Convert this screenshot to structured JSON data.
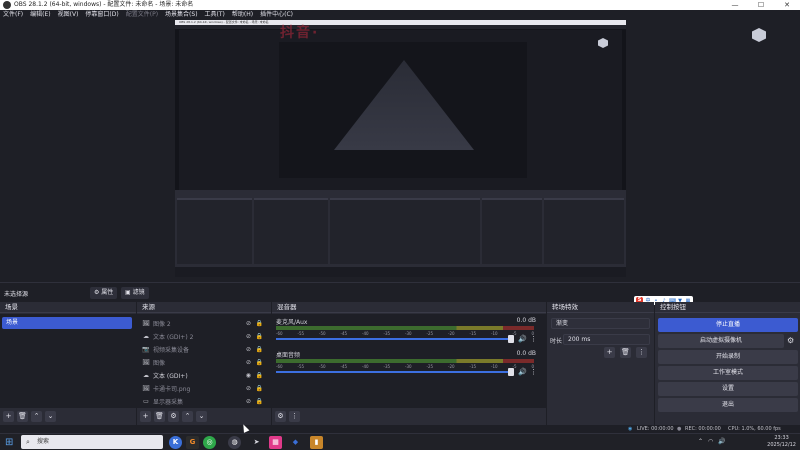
{
  "window": {
    "title": "OBS 28.1.2 (64-bit, windows) - 配置文件: 未命名 - 场景: 未命名",
    "minimize": "—",
    "maximize": "☐",
    "close": "✕"
  },
  "menu": [
    "文件(F)",
    "编辑(E)",
    "视图(V)",
    "停靠窗口(D)",
    "配置文件(P)",
    "场景集合(S)",
    "工具(T)",
    "帮助(H)",
    "插件中心(C)"
  ],
  "preview": {
    "nested_title": "OBS 28.1.2 (64-bit, windows) - 配置文件: 未命名 - 场景: 未命名"
  },
  "scene_bar": {
    "selected": "未选择源",
    "properties": "属性",
    "filters": "滤镜"
  },
  "ime": {
    "label": "中"
  },
  "scenes": {
    "title": "场景",
    "items": [
      "场景"
    ]
  },
  "sources": {
    "title": "来源",
    "items": [
      {
        "icon": "🖼",
        "label": "图像 2",
        "visible": false
      },
      {
        "icon": "☁",
        "label": "文本 (GDI+) 2",
        "visible": false
      },
      {
        "icon": "📷",
        "label": "视频采集设备",
        "visible": false
      },
      {
        "icon": "🖼",
        "label": "图像",
        "visible": false
      },
      {
        "icon": "☁",
        "label": "文本 (GDI+)",
        "visible": true
      },
      {
        "icon": "🖼",
        "label": "卡通卡司.png",
        "visible": false
      },
      {
        "icon": "▭",
        "label": "显示器采集",
        "visible": false
      }
    ]
  },
  "mixer": {
    "title": "混音器",
    "channels": [
      {
        "name": "麦克风/Aux",
        "db": "0.0 dB"
      },
      {
        "name": "桌面音频",
        "db": "0.0 dB"
      }
    ],
    "ticks": [
      "-60",
      "-55",
      "-50",
      "-45",
      "-40",
      "-35",
      "-30",
      "-25",
      "-20",
      "-15",
      "-10",
      "-5",
      "0"
    ]
  },
  "transitions": {
    "title": "转场特效",
    "type": "渐变",
    "duration_label": "时长",
    "duration": "200 ms"
  },
  "controls": {
    "title": "控制按钮",
    "buttons": [
      "停止直播",
      "启动虚拟摄像机",
      "开始录制",
      "工作室模式",
      "设置",
      "退出"
    ]
  },
  "status": {
    "live": "LIVE: 00:00:00",
    "rec": "REC: 00:00:00",
    "cpu": "CPU: 1.0%, 60.00 fps"
  },
  "taskbar": {
    "search": "搜索",
    "time": "23:33",
    "date": "2025/12/12"
  },
  "colors": {
    "accent": "#3c5bd1",
    "dock_bg": "#2b2c36",
    "panel_bg": "#1e1f26"
  }
}
